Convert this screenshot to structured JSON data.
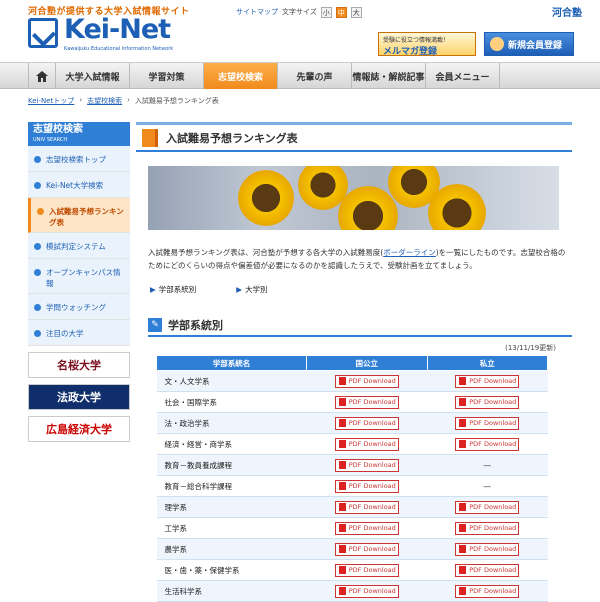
{
  "header": {
    "tagline": "河合塾が提供する大学入試情報サイト",
    "logo_text": "Kei-Net",
    "logo_sub": "Kawaijuku Educational Information Network",
    "sitemap": "サイトマップ",
    "font_size_label": "文字サイズ",
    "font_sizes": [
      "小",
      "中",
      "大"
    ],
    "brand": "河合塾",
    "magazine_small": "受験に役立つ情報満載！",
    "magazine_label": "メルマガ登録",
    "register_label": "新規会員登録"
  },
  "nav": {
    "items": [
      "大学入試情報",
      "学習対策",
      "志望校検索",
      "先輩の声",
      "情報誌・解説記事",
      "会員メニュー"
    ],
    "active_index": 2
  },
  "breadcrumb": [
    "Kei-Netトップ",
    "志望校検索",
    "入試難易予想ランキング表"
  ],
  "sidebar": {
    "title": "志望校検索",
    "subtitle": "UNIV SEARCH",
    "items": [
      "志望校検索トップ",
      "Kei-Net大学検索",
      "入試難易予想ランキング表",
      "模試判定システム",
      "オープンキャンパス情報",
      "学問ウォッチング",
      "注目の大学"
    ],
    "active_index": 2,
    "banners": [
      "名桜大学",
      "法政大学",
      "広島経済大学"
    ]
  },
  "main": {
    "title": "入試難易予想ランキング表",
    "desc_before": "入試難易予想ランキング表は、河合塾が予想する各大学の入試難易度(",
    "desc_link": "ボーダーライン",
    "desc_after": ")を一覧にしたものです。志望校合格のためにどのくらいの得点や偏差値が必要になるのかを認識したうえで、受験計画を立てましょう。",
    "anchors": [
      "学部系統別",
      "大学別"
    ],
    "section_title": "学部系統別",
    "updated": "(13/11/19更新)",
    "table": {
      "headers": [
        "学部系統名",
        "国公立",
        "私立"
      ],
      "pdf_label": "PDF Download",
      "dash": "—",
      "rows": [
        {
          "name": "文・人文学系",
          "national": true,
          "private": true
        },
        {
          "name": "社会・国際学系",
          "national": true,
          "private": true
        },
        {
          "name": "法・政治学系",
          "national": true,
          "private": true
        },
        {
          "name": "経済・経営・商学系",
          "national": true,
          "private": true
        },
        {
          "name": "教育－教員養成課程",
          "national": true,
          "private": false
        },
        {
          "name": "教育－総合科学課程",
          "national": true,
          "private": false
        },
        {
          "name": "理学系",
          "national": true,
          "private": true
        },
        {
          "name": "工学系",
          "national": true,
          "private": true
        },
        {
          "name": "農学系",
          "national": true,
          "private": true
        },
        {
          "name": "医・歯・薬・保健学系",
          "national": true,
          "private": true
        },
        {
          "name": "生活科学系",
          "national": true,
          "private": true
        }
      ]
    }
  },
  "colors": {
    "accent_orange": "#f08a1c",
    "brand_blue": "#1d5fb5",
    "section_blue": "#2f7fd6"
  }
}
